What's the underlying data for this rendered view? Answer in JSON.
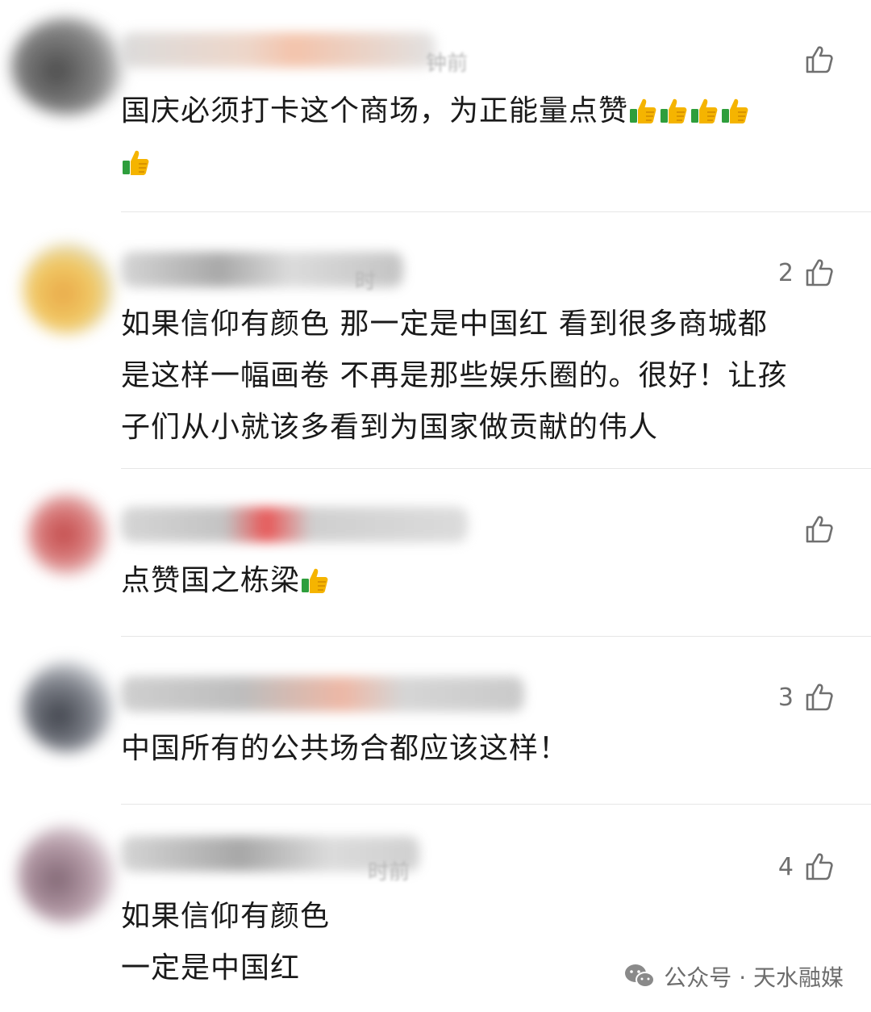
{
  "comments": [
    {
      "time_fragment": "钟前",
      "like_count": "",
      "text_lines": [
        "国庆必须打卡这个商场，为正能量点赞"
      ],
      "emoji_after_line1": 4,
      "emoji_line2": 1,
      "avatar_color": "#3a3a3a",
      "name_color": "#c8c8c8"
    },
    {
      "time_fragment": "时",
      "like_count": "2",
      "text_lines": [
        "如果信仰有颜色 那一定是中国红 看到很多商城都",
        "是这样一幅画卷 不再是那些娱乐圈的。很好！让孩",
        "子们从小就该多看到为国家做贡献的伟人"
      ],
      "avatar_color": "#e0a23a",
      "name_color": "#9a9a9a"
    },
    {
      "time_fragment": "",
      "like_count": "",
      "text_lines": [
        "点赞国之栋梁"
      ],
      "emoji_after_line1": 1,
      "avatar_color": "#c43a3a",
      "name_color": "#a0a0a0"
    },
    {
      "time_fragment": "",
      "like_count": "3",
      "text_lines": [
        "中国所有的公共场合都应该这样！"
      ],
      "avatar_color": "#2a2e38",
      "name_color": "#9a9a9a"
    },
    {
      "time_fragment": "时前",
      "like_count": "4",
      "text_lines": [
        "如果信仰有颜色",
        "一定是中国红"
      ],
      "avatar_color": "#8a6b7a",
      "name_color": "#a8a8a8"
    }
  ],
  "watermark": {
    "label": "公众号 · 天水融媒",
    "icon": "wechat-icon"
  },
  "icons": {
    "like": "thumb-up-outline-icon",
    "emoji": "thumbs-up-emoji"
  },
  "colors": {
    "text": "#1a1a1a",
    "meta": "#707070",
    "divider": "#e6e6e6",
    "emoji_yellow": "#f5b400",
    "emoji_green": "#2e9e3c"
  }
}
